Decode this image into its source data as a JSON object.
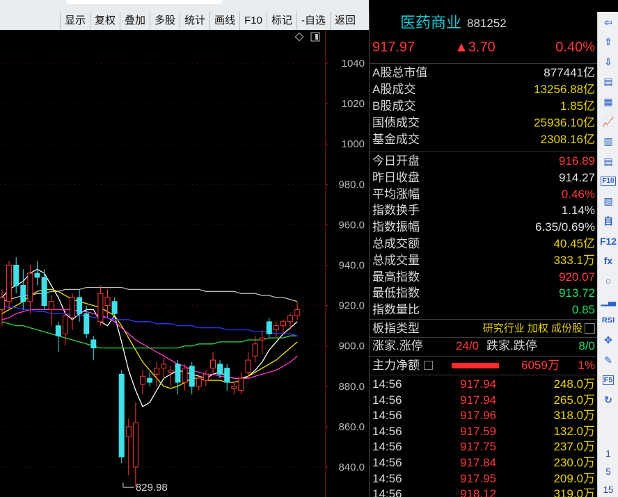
{
  "toolbar": {
    "buttons": [
      "显示",
      "复权",
      "叠加",
      "多股",
      "统计",
      "画线",
      "F10",
      "标记",
      "-自选",
      "返回"
    ]
  },
  "quote": {
    "name": "医药商业",
    "code": "881252",
    "price": "917.97",
    "change": "▲3.70",
    "change_pct": "0.40%"
  },
  "market_rows": [
    {
      "label": "A股总市值",
      "value": "877441亿",
      "color": "white"
    },
    {
      "label": "A股成交",
      "value": "13256.88亿",
      "color": "yellow"
    },
    {
      "label": "B股成交",
      "value": "1.85亿",
      "color": "yellow"
    },
    {
      "label": "国债成交",
      "value": "25936.10亿",
      "color": "yellow"
    },
    {
      "label": "基金成交",
      "value": "2308.16亿",
      "color": "yellow"
    }
  ],
  "index_rows": [
    {
      "label": "今日开盘",
      "value": "916.89",
      "color": "red"
    },
    {
      "label": "昨日收盘",
      "value": "914.27",
      "color": "white"
    },
    {
      "label": "平均涨幅",
      "value": "0.46%",
      "color": "red"
    },
    {
      "label": "指数换手",
      "value": "1.14%",
      "color": "white"
    },
    {
      "label": "指数振幅",
      "value": "6.35/0.69%",
      "color": "white"
    },
    {
      "label": "总成交额",
      "value": "40.45亿",
      "color": "yellow"
    },
    {
      "label": "总成交量",
      "value": "333.1万",
      "color": "yellow"
    },
    {
      "label": "最高指数",
      "value": "920.07",
      "color": "red"
    },
    {
      "label": "最低指数",
      "value": "913.72",
      "color": "green"
    },
    {
      "label": "指数量比",
      "value": "0.85",
      "color": "green"
    }
  ],
  "sector": {
    "label": "板指类型",
    "value": "研究行业 加权 成份股"
  },
  "limits": {
    "label1": "涨家.涨停",
    "value1": "24/0",
    "label2": "跌家.跌停",
    "value2": "8/0"
  },
  "mainflow": {
    "label": "主力净额",
    "amount": "6059万",
    "pct": "1%"
  },
  "ticks": [
    {
      "time": "14:56",
      "price": "917.94",
      "vol": "248.0万"
    },
    {
      "time": "14:56",
      "price": "917.94",
      "vol": "265.0万"
    },
    {
      "time": "14:56",
      "price": "917.96",
      "vol": "318.0万"
    },
    {
      "time": "14:56",
      "price": "917.59",
      "vol": "132.0万"
    },
    {
      "time": "14:56",
      "price": "917.75",
      "vol": "237.0万"
    },
    {
      "time": "14:56",
      "price": "917.84",
      "vol": "230.0万"
    },
    {
      "time": "14:56",
      "price": "917.95",
      "vol": "209.0万"
    },
    {
      "time": "14:56",
      "price": "918.12",
      "vol": "319.0万"
    }
  ],
  "colors": {
    "up": "#ff3b3b",
    "down": "#3fe0e8",
    "ma5": "#ffffff",
    "ma10": "#f2e600",
    "ma20": "#ff3bd6",
    "ma30": "#2fd84a",
    "ma60": "#2a3bff",
    "ma120": "#bdbdbd",
    "name": "#19c8d8"
  },
  "iconbar": {
    "icons": [
      "arrow-left-icon",
      "arrow-up-icon",
      "arrow-down-icon",
      "list-icon",
      "grid-icon",
      "line-chart-icon",
      "kline-chart-icon",
      "table-icon",
      "f10-icon",
      "tree-icon",
      "self-select-icon",
      "f12-icon",
      "fx-icon",
      "circle-icon",
      "volume-icon",
      "rsi-icon",
      "move-icon",
      "pencil-icon",
      "f5-icon",
      "refresh-icon"
    ],
    "labels": [
      "F10",
      "RSI",
      "F5"
    ],
    "numbers": [
      "1",
      "5",
      "15"
    ]
  },
  "chart_data": {
    "type": "candlestick",
    "y_ticks": [
      "1040",
      "1020",
      "1000",
      "980.0",
      "960.0",
      "940.0",
      "920.0",
      "900.0",
      "880.0",
      "860.0",
      "840.0"
    ],
    "ylim": [
      826,
      1050
    ],
    "low_marker": "829.98",
    "candles": [
      {
        "o": 918,
        "h": 928,
        "l": 910,
        "c": 924
      },
      {
        "o": 922,
        "h": 942,
        "l": 918,
        "c": 940
      },
      {
        "o": 940,
        "h": 944,
        "l": 926,
        "c": 930
      },
      {
        "o": 930,
        "h": 938,
        "l": 918,
        "c": 922
      },
      {
        "o": 922,
        "h": 940,
        "l": 916,
        "c": 936
      },
      {
        "o": 936,
        "h": 942,
        "l": 930,
        "c": 934
      },
      {
        "o": 934,
        "h": 938,
        "l": 918,
        "c": 920
      },
      {
        "o": 918,
        "h": 925,
        "l": 910,
        "c": 922
      },
      {
        "o": 910,
        "h": 912,
        "l": 897,
        "c": 905
      },
      {
        "o": 906,
        "h": 918,
        "l": 900,
        "c": 915
      },
      {
        "o": 914,
        "h": 926,
        "l": 908,
        "c": 924
      },
      {
        "o": 924,
        "h": 928,
        "l": 912,
        "c": 916
      },
      {
        "o": 916,
        "h": 920,
        "l": 904,
        "c": 906
      },
      {
        "o": 903,
        "h": 905,
        "l": 893,
        "c": 899
      },
      {
        "o": 912,
        "h": 930,
        "l": 910,
        "c": 926
      },
      {
        "o": 920,
        "h": 928,
        "l": 914,
        "c": 924
      },
      {
        "o": 922,
        "h": 924,
        "l": 915,
        "c": 916
      },
      {
        "o": 886,
        "h": 888,
        "l": 842,
        "c": 845
      },
      {
        "o": 855,
        "h": 864,
        "l": 836,
        "c": 860
      },
      {
        "o": 840,
        "h": 872,
        "l": 830,
        "c": 862
      },
      {
        "o": 881,
        "h": 888,
        "l": 876,
        "c": 885
      },
      {
        "o": 884,
        "h": 887,
        "l": 880,
        "c": 882
      },
      {
        "o": 886,
        "h": 892,
        "l": 880,
        "c": 889
      },
      {
        "o": 889,
        "h": 894,
        "l": 884,
        "c": 891
      },
      {
        "o": 887,
        "h": 890,
        "l": 880,
        "c": 888
      },
      {
        "o": 891,
        "h": 893,
        "l": 876,
        "c": 882
      },
      {
        "o": 882,
        "h": 891,
        "l": 878,
        "c": 889
      },
      {
        "o": 890,
        "h": 892,
        "l": 876,
        "c": 880
      },
      {
        "o": 880,
        "h": 886,
        "l": 878,
        "c": 884
      },
      {
        "o": 883,
        "h": 888,
        "l": 880,
        "c": 886
      },
      {
        "o": 889,
        "h": 897,
        "l": 886,
        "c": 893
      },
      {
        "o": 891,
        "h": 893,
        "l": 884,
        "c": 886
      },
      {
        "o": 889,
        "h": 891,
        "l": 878,
        "c": 882
      },
      {
        "o": 879,
        "h": 882,
        "l": 876,
        "c": 880
      },
      {
        "o": 878,
        "h": 887,
        "l": 876,
        "c": 884
      },
      {
        "o": 887,
        "h": 897,
        "l": 884,
        "c": 893
      },
      {
        "o": 895,
        "h": 905,
        "l": 892,
        "c": 901
      },
      {
        "o": 903,
        "h": 908,
        "l": 896,
        "c": 904
      },
      {
        "o": 912,
        "h": 914,
        "l": 904,
        "c": 906
      },
      {
        "o": 908,
        "h": 912,
        "l": 904,
        "c": 910
      },
      {
        "o": 910,
        "h": 913,
        "l": 906,
        "c": 912
      },
      {
        "o": 912,
        "h": 916,
        "l": 908,
        "c": 915
      },
      {
        "o": 915,
        "h": 922,
        "l": 913,
        "c": 918
      }
    ],
    "ma_lines": [
      {
        "name": "ma5",
        "values": [
          924,
          928,
          930,
          932,
          936,
          938,
          936,
          930,
          924,
          916,
          913,
          916,
          918,
          918,
          912,
          910,
          915,
          902,
          888,
          878,
          870,
          872,
          878,
          884,
          886,
          888,
          887,
          886,
          885,
          884,
          886,
          887,
          885,
          884,
          884,
          885,
          888,
          892,
          898,
          902,
          906,
          909,
          912
        ]
      },
      {
        "name": "ma10",
        "values": [
          916,
          918,
          920,
          922,
          925,
          927,
          928,
          928,
          927,
          925,
          923,
          922,
          921,
          920,
          919,
          917,
          915,
          910,
          904,
          898,
          892,
          888,
          884,
          880,
          879,
          880,
          882,
          884,
          884,
          883,
          883,
          883,
          882,
          882,
          883,
          885,
          887,
          889,
          891,
          893,
          896,
          899,
          902
        ]
      },
      {
        "name": "ma20",
        "values": [
          913,
          914,
          916,
          917,
          918,
          918,
          918,
          918,
          918,
          918,
          918,
          917,
          917,
          916,
          915,
          914,
          912,
          909,
          906,
          903,
          901,
          899,
          897,
          895,
          893,
          891,
          890,
          888,
          887,
          886,
          886,
          885,
          885,
          884,
          884,
          884,
          885,
          886,
          887,
          888,
          890,
          892,
          895
        ]
      },
      {
        "name": "ma30",
        "values": [
          912,
          911,
          910,
          910,
          909,
          908,
          907,
          906,
          905,
          904,
          903,
          902,
          901,
          900,
          899,
          899,
          899,
          899,
          899,
          899,
          899,
          899,
          899,
          899,
          899,
          899,
          900,
          900,
          901,
          901,
          901,
          902,
          902,
          902,
          902,
          903,
          903,
          903,
          904,
          904,
          904,
          905,
          905
        ]
      },
      {
        "name": "ma60",
        "values": [
          920,
          919,
          919,
          918,
          918,
          917,
          917,
          916,
          916,
          916,
          915,
          915,
          915,
          914,
          914,
          914,
          913,
          913,
          913,
          912,
          912,
          912,
          911,
          911,
          911,
          910,
          910,
          910,
          909,
          909,
          909,
          909,
          908,
          908,
          908,
          908,
          907,
          907,
          907,
          906,
          906,
          906,
          905
        ]
      },
      {
        "name": "ma120",
        "values": [
          922,
          923,
          924,
          925,
          925,
          926,
          926,
          927,
          927,
          928,
          928,
          928,
          929,
          929,
          929,
          929,
          929,
          929,
          928,
          928,
          928,
          928,
          928,
          928,
          928,
          928,
          928,
          928,
          928,
          927,
          927,
          927,
          927,
          927,
          926,
          926,
          926,
          925,
          925,
          924,
          924,
          923,
          922
        ]
      }
    ]
  }
}
